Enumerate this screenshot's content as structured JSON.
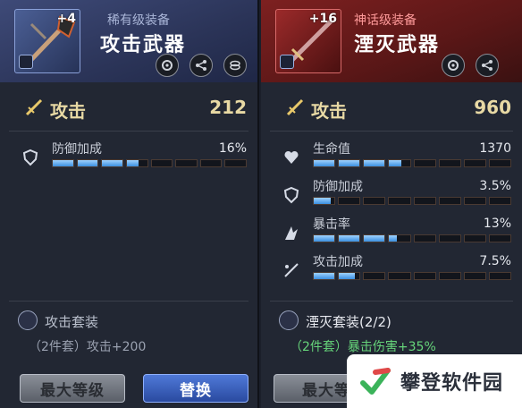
{
  "left": {
    "thumb_level": "+4",
    "rarity": "稀有级装备",
    "title": "攻击武器",
    "header_icons": [
      "swap-icon",
      "share-icon",
      "coin-icon"
    ],
    "attack": {
      "label": "攻击",
      "value": "212"
    },
    "stats": [
      {
        "icon": "shield-icon",
        "name": "防御加成",
        "value": "16%",
        "fill": 0.45
      }
    ],
    "set": {
      "name": "攻击套装",
      "bonus": "（2件套）攻击+200"
    },
    "buttons": {
      "max_level": "最大等级",
      "replace": "替换"
    }
  },
  "right": {
    "thumb_level": "+16",
    "rarity": "神话级装备",
    "title": "湮灭武器",
    "header_icons": [
      "swap-icon",
      "share-icon"
    ],
    "attack": {
      "label": "攻击",
      "value": "960"
    },
    "stats": [
      {
        "icon": "heart-icon",
        "name": "生命值",
        "value": "1370",
        "fill": 0.45
      },
      {
        "icon": "shield-icon",
        "name": "防御加成",
        "value": "3.5%",
        "fill": 0.1
      },
      {
        "icon": "crit-icon",
        "name": "暴击率",
        "value": "13%",
        "fill": 0.42
      },
      {
        "icon": "attack-bonus-icon",
        "name": "攻击加成",
        "value": "7.5%",
        "fill": 0.22
      }
    ],
    "set": {
      "name": "湮灭套装(2/2)",
      "bonus": "（2件套）暴击伤害+35%"
    },
    "buttons": {
      "max_level": "最大等"
    }
  },
  "watermark": {
    "text": "攀登软件园"
  },
  "colors": {
    "bar_fill": "#3a8fe0",
    "attack_text": "#e8d9a4",
    "set_bonus_active": "#66d47a"
  }
}
